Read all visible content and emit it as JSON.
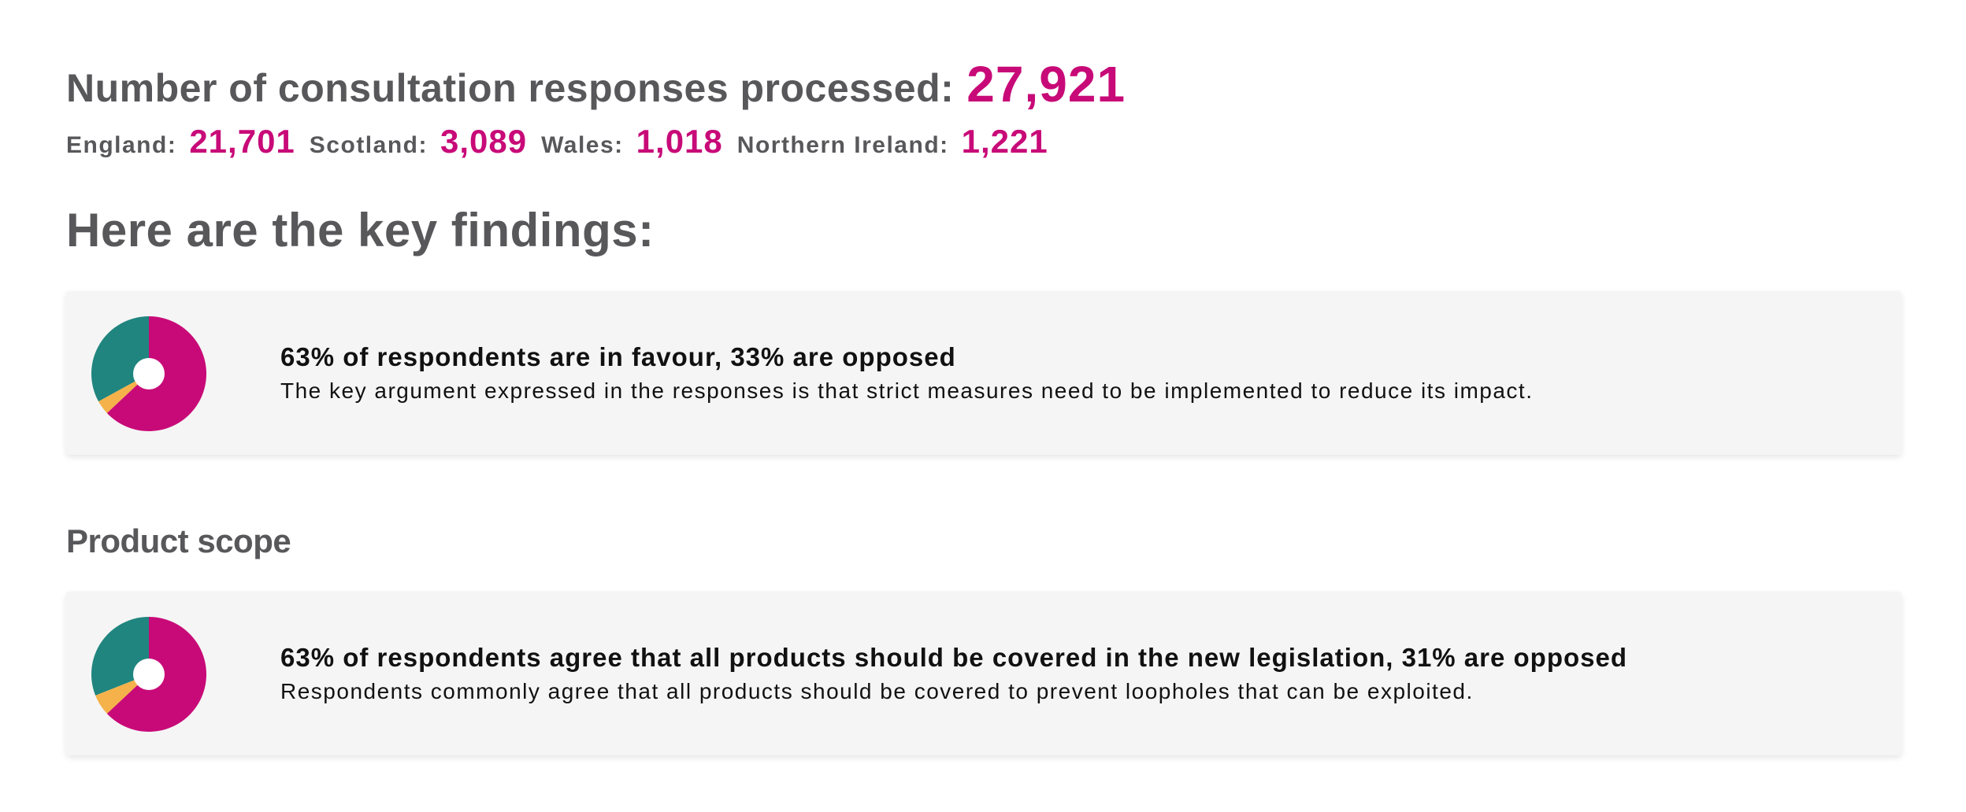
{
  "summary": {
    "total_label": "Number of consultation responses processed:",
    "total_value": "27,921",
    "nations": [
      {
        "label": "England:",
        "value": "21,701"
      },
      {
        "label": "Scotland:",
        "value": "3,089"
      },
      {
        "label": "Wales:",
        "value": "1,018"
      },
      {
        "label": "Northern Ireland:",
        "value": "1,221"
      }
    ]
  },
  "findings": {
    "heading": "Here are the key findings:",
    "cards": [
      {
        "title": "63% of respondents are in favour, 33% are opposed",
        "description": "The key argument expressed in the responses is that strict measures need to be implemented to reduce its impact.",
        "chart_data": {
          "type": "pie",
          "series": [
            {
              "value": 63,
              "color": "#c80a78"
            },
            {
              "value": 4,
              "color": "#f5b24a"
            },
            {
              "value": 33,
              "color": "#20857f"
            }
          ]
        }
      }
    ]
  },
  "product_scope": {
    "heading": "Product scope",
    "cards": [
      {
        "title": "63% of respondents agree that all products should be covered in the new legislation, 31% are opposed",
        "description": "Respondents commonly agree that all products should be covered to prevent loopholes that can be exploited.",
        "chart_data": {
          "type": "pie",
          "series": [
            {
              "value": 63,
              "color": "#c80a78"
            },
            {
              "value": 6,
              "color": "#f5b24a"
            },
            {
              "value": 31,
              "color": "#20857f"
            }
          ]
        }
      }
    ]
  },
  "colors": {
    "accent": "#c80a78",
    "heading": "#58585b",
    "card_background": "#f5f5f5",
    "teal": "#20857f",
    "amber": "#f5b24a"
  }
}
